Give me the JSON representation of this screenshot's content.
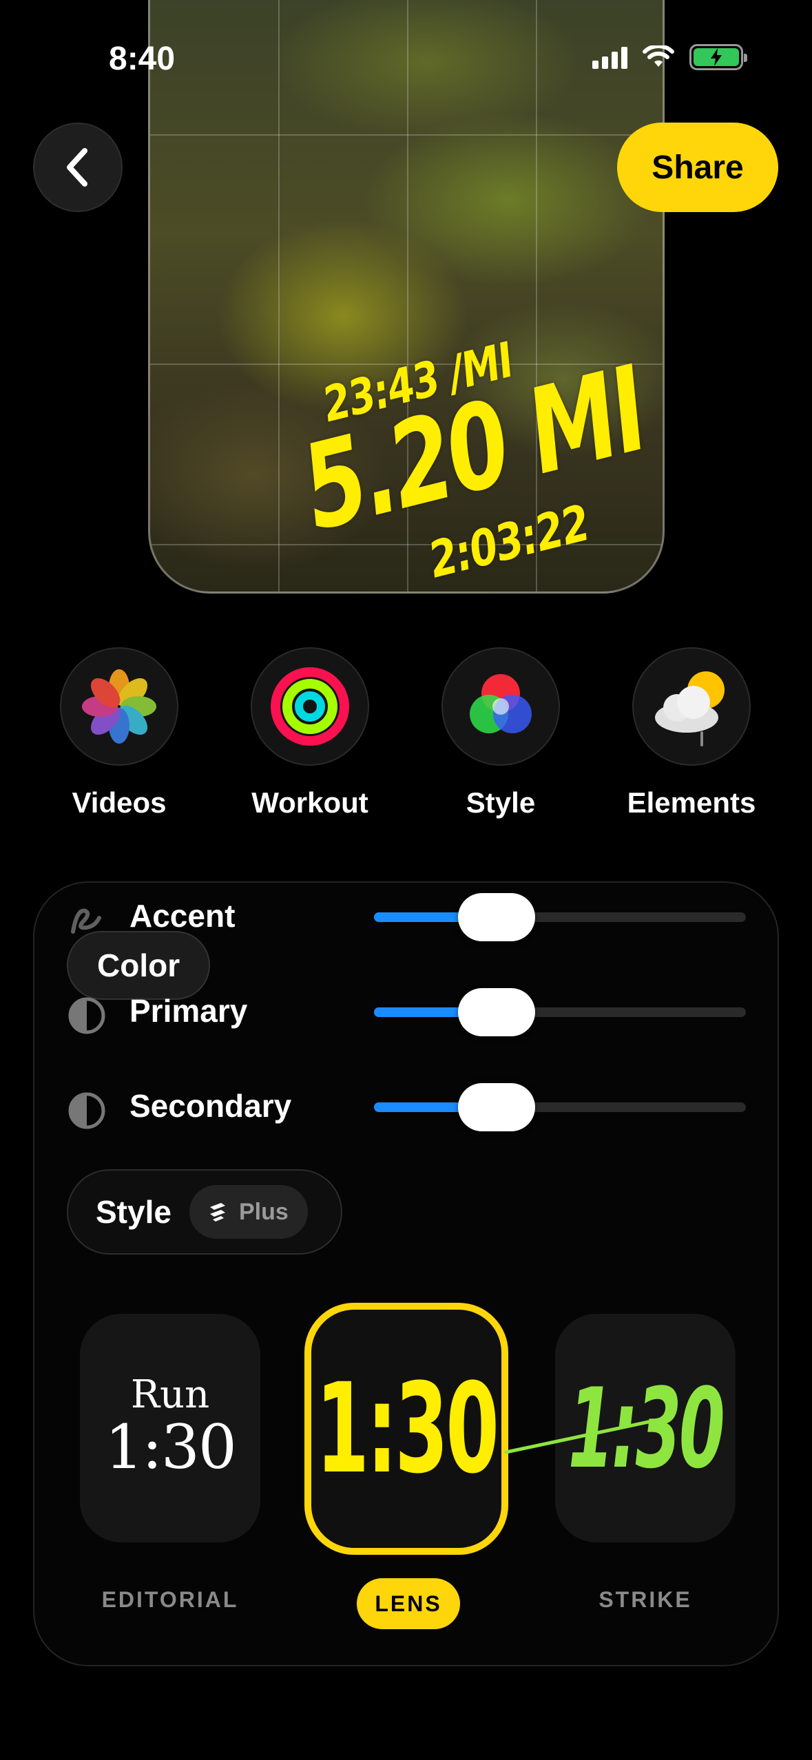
{
  "status_bar": {
    "time": "8:40"
  },
  "top_bar": {
    "share_label": "Share"
  },
  "preview": {
    "pace": "23:43 /MI",
    "distance": "5.20 MI",
    "duration": "2:03:22"
  },
  "categories": [
    {
      "label": "Videos",
      "icon": "photos-icon"
    },
    {
      "label": "Workout",
      "icon": "activity-rings-icon"
    },
    {
      "label": "Style",
      "icon": "color-circles-icon"
    },
    {
      "label": "Elements",
      "icon": "weather-icon"
    }
  ],
  "color_panel": {
    "tooltip": "Color",
    "rows": [
      {
        "label": "Accent",
        "icon": "accent-brush-icon",
        "value": 0.33
      },
      {
        "label": "Primary",
        "icon": "contrast-icon",
        "value": 0.33
      },
      {
        "label": "Secondary",
        "icon": "contrast-icon",
        "value": 0.33
      }
    ]
  },
  "style_section": {
    "label": "Style",
    "badge": "Plus",
    "cards": [
      {
        "label": "EDITORIAL",
        "line1": "Run",
        "line2": "1:30",
        "selected": false
      },
      {
        "label": "LENS",
        "text": "1:30",
        "selected": true
      },
      {
        "label": "STRIKE",
        "text": "1:30",
        "selected": false
      }
    ]
  },
  "colors": {
    "accent_yellow": "#ffd60a",
    "slider_blue": "#1a8cff",
    "strike_green": "#8ee53f",
    "battery_green": "#33c759"
  }
}
